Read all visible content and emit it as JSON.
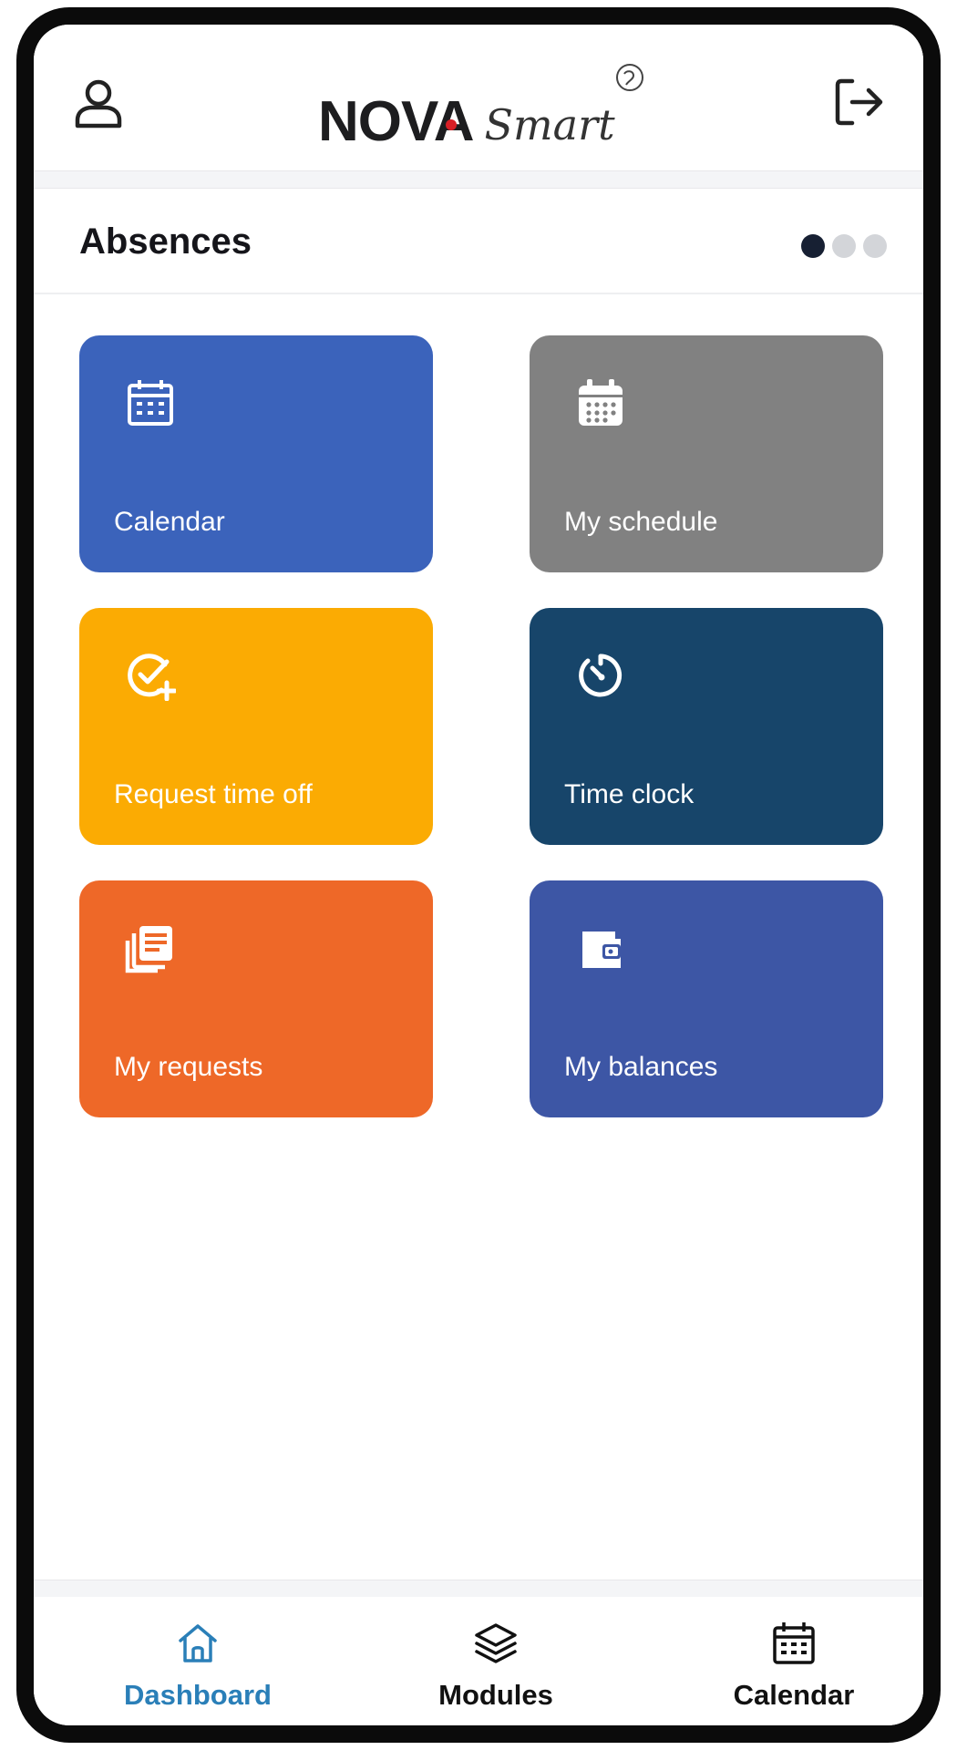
{
  "header": {
    "logo": {
      "brand": "NOVA",
      "product": "Smart"
    },
    "user_icon": "user-icon",
    "logout_icon": "logout-icon"
  },
  "section": {
    "title": "Absences",
    "pager": {
      "pages": 3,
      "active": 1
    }
  },
  "tiles": [
    {
      "label": "Calendar",
      "icon": "calendar-icon",
      "color": "#3b63bb"
    },
    {
      "label": "My schedule",
      "icon": "calendar-grid-icon",
      "color": "#818181"
    },
    {
      "label": "Request time off",
      "icon": "check-plus-icon",
      "color": "#fbab03"
    },
    {
      "label": "Time clock",
      "icon": "timer-icon",
      "color": "#17456a"
    },
    {
      "label": "My requests",
      "icon": "requests-icon",
      "color": "#ee6828"
    },
    {
      "label": "My balances",
      "icon": "wallet-icon",
      "color": "#3d56a5"
    }
  ],
  "nav": {
    "items": [
      {
        "label": "Dashboard",
        "icon": "home-icon",
        "active": true
      },
      {
        "label": "Modules",
        "icon": "layers-icon",
        "active": false
      },
      {
        "label": "Calendar",
        "icon": "calendar-icon",
        "active": false
      }
    ],
    "active_color": "#2a7fb8"
  }
}
